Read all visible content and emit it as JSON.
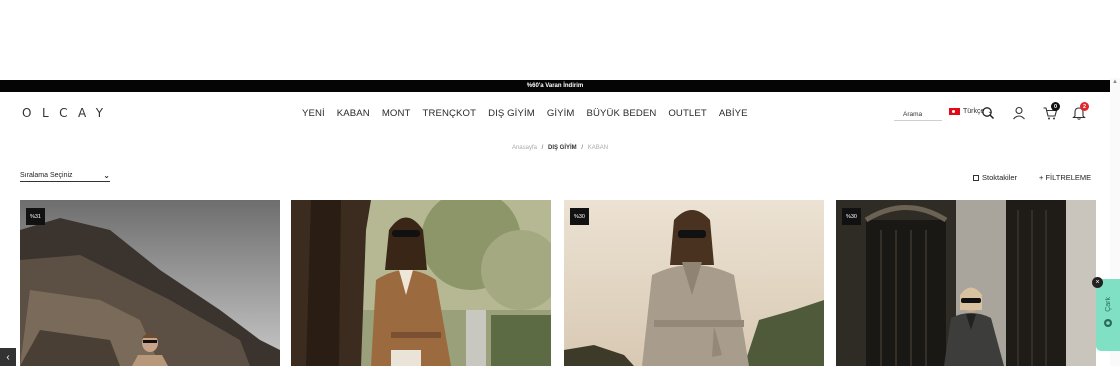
{
  "promo": {
    "text": "%60'a Varan İndirim"
  },
  "header": {
    "logo": "OLCAY",
    "nav": [
      "YENİ",
      "KABAN",
      "MONT",
      "TRENÇKOT",
      "DIŞ GİYİM",
      "GİYİM",
      "BÜYÜK BEDEN",
      "OUTLET",
      "ABİYE"
    ],
    "search_placeholder": "Arama",
    "language": "Türkçe",
    "cart_count": "0",
    "notification_count": "2",
    "colors": {
      "cart_badge": "#111111",
      "notification_badge": "#e3262c"
    }
  },
  "breadcrumb": {
    "home": "Anasayfa",
    "separator": "/",
    "category": "DIŞ GİYİM",
    "current": "KABAN"
  },
  "listing": {
    "sort_label": "Sıralama Seçiniz",
    "stock_filter_label": "Stoktakiler",
    "filter_label": "+ FİLTRELEME"
  },
  "products": [
    {
      "badge": "%31"
    },
    {
      "badge": ""
    },
    {
      "badge": "%30"
    },
    {
      "badge": "%30"
    }
  ],
  "chat": {
    "label": "Çark"
  }
}
